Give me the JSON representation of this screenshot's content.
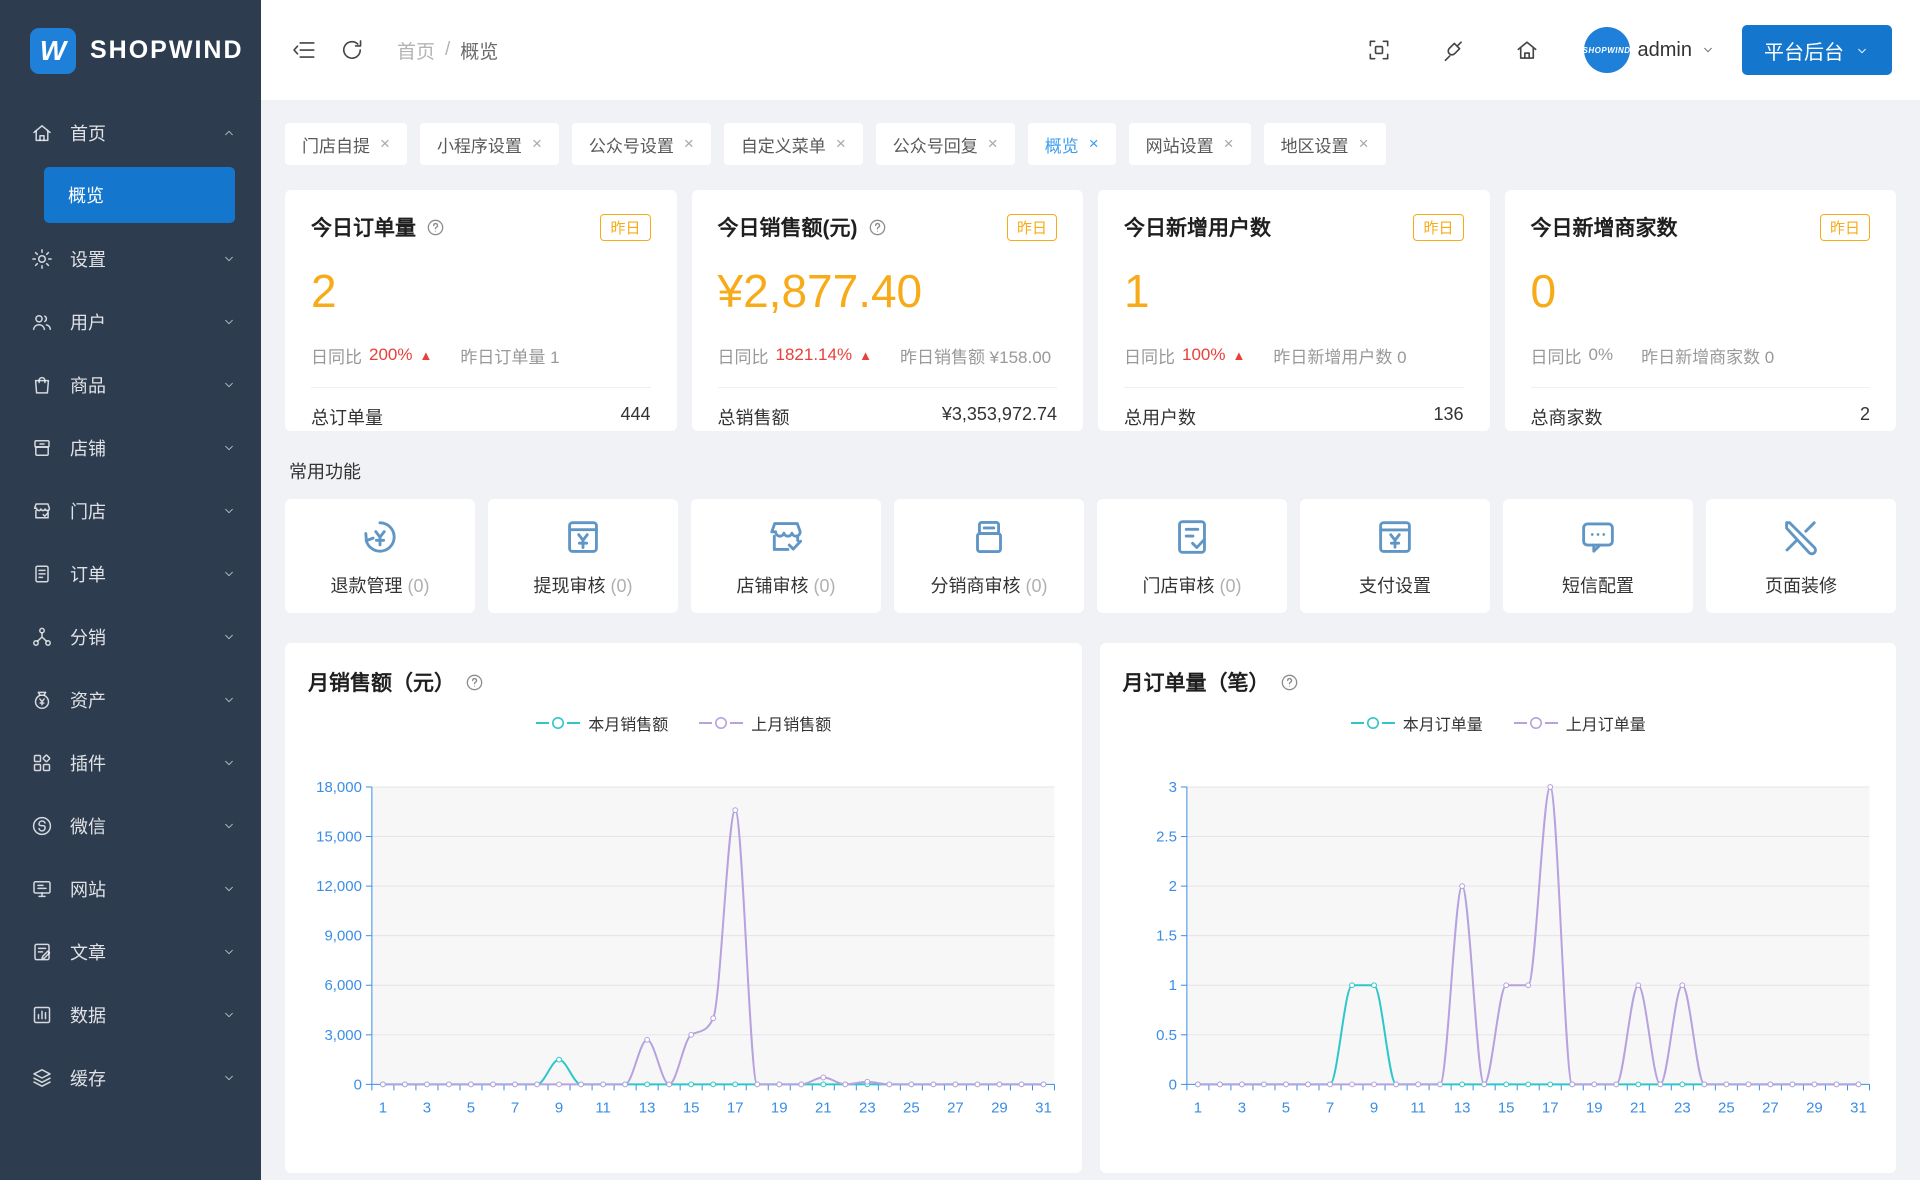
{
  "colors": {
    "sidebar_bg": "#2e3c50",
    "accent_blue": "#1476cd",
    "active_tab": "#3d9ef0",
    "orange": "#f8ab18",
    "red": "#e8403a",
    "teal": "#2ec7c9",
    "purple": "#b6a2de",
    "axis_blue": "#3a8ee6",
    "icon_steel_blue": "#6096c5"
  },
  "sidebar": {
    "logo": {
      "monogram": "W",
      "text": "SHOPWIND"
    },
    "items": [
      {
        "label": "首页",
        "icon": "home-icon",
        "expanded": true,
        "children": [
          {
            "label": "概览",
            "active": true
          }
        ]
      },
      {
        "label": "设置",
        "icon": "gear-icon"
      },
      {
        "label": "用户",
        "icon": "users-icon"
      },
      {
        "label": "商品",
        "icon": "goods-icon"
      },
      {
        "label": "店铺",
        "icon": "shop-icon"
      },
      {
        "label": "门店",
        "icon": "store-icon"
      },
      {
        "label": "订单",
        "icon": "order-icon"
      },
      {
        "label": "分销",
        "icon": "distribution-icon"
      },
      {
        "label": "资产",
        "icon": "asset-icon"
      },
      {
        "label": "插件",
        "icon": "plugin-icon"
      },
      {
        "label": "微信",
        "icon": "wechat-icon"
      },
      {
        "label": "网站",
        "icon": "website-icon"
      },
      {
        "label": "文章",
        "icon": "article-icon"
      },
      {
        "label": "数据",
        "icon": "data-icon"
      },
      {
        "label": "缓存",
        "icon": "cache-icon"
      }
    ]
  },
  "header": {
    "breadcrumb_home": "首页",
    "breadcrumb_sep": "/",
    "breadcrumb_current": "概览",
    "user": "admin",
    "platform_button": "平台后台",
    "avatar_text": "SHOPWIND",
    "left_icons": [
      "collapse-menu-icon",
      "refresh-icon"
    ],
    "right_icons": [
      "fullscreen-icon",
      "brush-icon",
      "home-icon"
    ]
  },
  "tabs": [
    {
      "label": "门店自提"
    },
    {
      "label": "小程序设置"
    },
    {
      "label": "公众号设置"
    },
    {
      "label": "自定义菜单"
    },
    {
      "label": "公众号回复"
    },
    {
      "label": "概览",
      "active": true
    },
    {
      "label": "网站设置"
    },
    {
      "label": "地区设置"
    }
  ],
  "stats": [
    {
      "title": "今日订单量",
      "help": true,
      "badge": "昨日",
      "value": "2",
      "compare_label": "日同比",
      "compare_value": "200%",
      "trend": "up",
      "yesterday_text": "昨日订单量 1",
      "total_label": "总订单量",
      "total_value": "444"
    },
    {
      "title": "今日销售额(元)",
      "help": true,
      "badge": "昨日",
      "value": "¥2,877.40",
      "compare_label": "日同比",
      "compare_value": "1821.14%",
      "trend": "up",
      "yesterday_text": "昨日销售额 ¥158.00",
      "total_label": "总销售额",
      "total_value": "¥3,353,972.74"
    },
    {
      "title": "今日新增用户数",
      "help": false,
      "badge": "昨日",
      "value": "1",
      "compare_label": "日同比",
      "compare_value": "100%",
      "trend": "up",
      "yesterday_text": "昨日新增用户数 0",
      "total_label": "总用户数",
      "total_value": "136"
    },
    {
      "title": "今日新增商家数",
      "help": false,
      "badge": "昨日",
      "value": "0",
      "compare_label": "日同比",
      "compare_value": "0%",
      "trend": "none",
      "yesterday_text": "昨日新增商家数 0",
      "total_label": "总商家数",
      "total_value": "2"
    }
  ],
  "quick": {
    "section_label": "常用功能",
    "items": [
      {
        "label": "退款管理",
        "count": "(0)",
        "icon": "refund-icon"
      },
      {
        "label": "提现审核",
        "count": "(0)",
        "icon": "withdraw-icon"
      },
      {
        "label": "店铺审核",
        "count": "(0)",
        "icon": "shop-audit-icon"
      },
      {
        "label": "分销商审核",
        "count": "(0)",
        "icon": "distributor-audit-icon"
      },
      {
        "label": "门店审核",
        "count": "(0)",
        "icon": "store-audit-icon"
      },
      {
        "label": "支付设置",
        "count": "",
        "icon": "payment-icon"
      },
      {
        "label": "短信配置",
        "count": "",
        "icon": "sms-icon"
      },
      {
        "label": "页面装修",
        "count": "",
        "icon": "decorate-icon"
      }
    ]
  },
  "chart_data": [
    {
      "type": "line",
      "title": "月销售额（元）",
      "help": true,
      "x": [
        1,
        2,
        3,
        4,
        5,
        6,
        7,
        8,
        9,
        10,
        11,
        12,
        13,
        14,
        15,
        16,
        17,
        18,
        19,
        20,
        21,
        22,
        23,
        24,
        25,
        26,
        27,
        28,
        29,
        30,
        31
      ],
      "xtick_labels": [
        "1",
        "3",
        "5",
        "7",
        "9",
        "11",
        "13",
        "15",
        "17",
        "19",
        "21",
        "23",
        "25",
        "27",
        "29",
        "31"
      ],
      "ylim": [
        0,
        18000
      ],
      "ytick_labels": [
        "0",
        "3,000",
        "6,000",
        "9,000",
        "12,000",
        "15,000",
        "18,000"
      ],
      "grid": true,
      "legend_position": "top",
      "series": [
        {
          "name": "本月销售额",
          "color": "#2ec7c9",
          "values": [
            0,
            0,
            0,
            0,
            0,
            0,
            0,
            0,
            1500,
            0,
            0,
            0,
            0,
            0,
            0,
            0,
            0,
            0,
            0,
            0,
            0,
            0,
            0,
            0,
            0,
            0,
            0,
            0,
            0,
            0,
            0
          ]
        },
        {
          "name": "上月销售额",
          "color": "#b6a2de",
          "values": [
            0,
            0,
            0,
            0,
            0,
            0,
            0,
            0,
            0,
            0,
            0,
            0,
            2700,
            0,
            3000,
            4000,
            16600,
            0,
            0,
            0,
            420,
            0,
            160,
            0,
            0,
            0,
            0,
            0,
            0,
            0,
            0
          ]
        }
      ]
    },
    {
      "type": "line",
      "title": "月订单量（笔）",
      "help": true,
      "x": [
        1,
        2,
        3,
        4,
        5,
        6,
        7,
        8,
        9,
        10,
        11,
        12,
        13,
        14,
        15,
        16,
        17,
        18,
        19,
        20,
        21,
        22,
        23,
        24,
        25,
        26,
        27,
        28,
        29,
        30,
        31
      ],
      "xtick_labels": [
        "1",
        "3",
        "5",
        "7",
        "9",
        "11",
        "13",
        "15",
        "17",
        "19",
        "21",
        "23",
        "25",
        "27",
        "29",
        "31"
      ],
      "ylim": [
        0,
        3
      ],
      "ytick_labels": [
        "0",
        "0.5",
        "1",
        "1.5",
        "2",
        "2.5",
        "3"
      ],
      "grid": true,
      "legend_position": "top",
      "series": [
        {
          "name": "本月订单量",
          "color": "#2ec7c9",
          "values": [
            0,
            0,
            0,
            0,
            0,
            0,
            0,
            1,
            1,
            0,
            0,
            0,
            0,
            0,
            0,
            0,
            0,
            0,
            0,
            0,
            0,
            0,
            0,
            0,
            0,
            0,
            0,
            0,
            0,
            0,
            0
          ]
        },
        {
          "name": "上月订单量",
          "color": "#b6a2de",
          "values": [
            0,
            0,
            0,
            0,
            0,
            0,
            0,
            0,
            0,
            0,
            0,
            0,
            2,
            0,
            1,
            1,
            3,
            0,
            0,
            0,
            1,
            0,
            1,
            0,
            0,
            0,
            0,
            0,
            0,
            0,
            0
          ]
        }
      ]
    }
  ]
}
